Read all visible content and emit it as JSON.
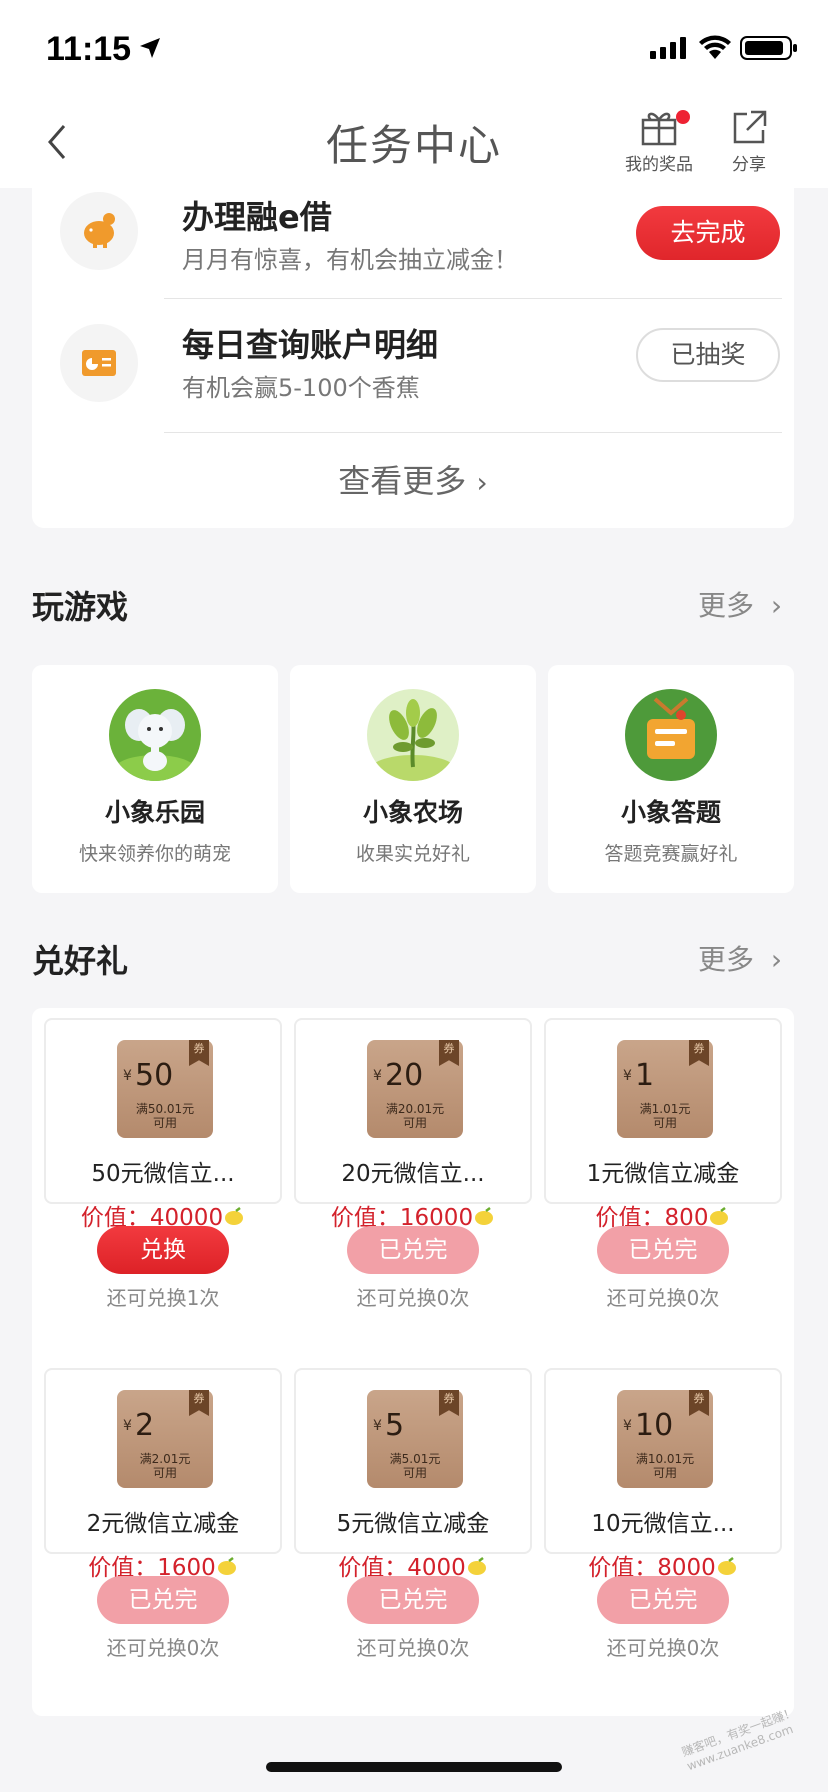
{
  "status": {
    "time": "11:15"
  },
  "nav": {
    "title": "任务中心",
    "prize_label": "我的奖品",
    "share_label": "分享"
  },
  "tasks": [
    {
      "title": "办理融e借",
      "subtitle": "月月有惊喜，有机会抽立减金！",
      "button": "去完成"
    },
    {
      "title": "每日查询账户明细",
      "subtitle": "有机会赢5-100个香蕉",
      "button": "已抽奖"
    }
  ],
  "see_more": "查看更多",
  "games": {
    "title": "玩游戏",
    "more": "更多",
    "items": [
      {
        "name": "小象乐园",
        "desc": "快来领养你的萌宠"
      },
      {
        "name": "小象农场",
        "desc": "收果实兑好礼"
      },
      {
        "name": "小象答题",
        "desc": "答题竞赛赢好礼"
      }
    ]
  },
  "gifts": {
    "title": "兑好礼",
    "more": "更多",
    "coupon_tag": "券",
    "yen": "¥",
    "usable": "可用",
    "price_label": "价值：",
    "items": [
      {
        "amount": "50",
        "condition": "满50.01元",
        "name": "50元微信立...",
        "price": "40000",
        "button": "兑换",
        "remain": "还可兑换1次"
      },
      {
        "amount": "20",
        "condition": "满20.01元",
        "name": "20元微信立...",
        "price": "16000",
        "button": "已兑完",
        "remain": "还可兑换0次"
      },
      {
        "amount": "1",
        "condition": "满1.01元",
        "name": "1元微信立减金",
        "price": "800",
        "button": "已兑完",
        "remain": "还可兑换0次"
      },
      {
        "amount": "2",
        "condition": "满2.01元",
        "name": "2元微信立减金",
        "price": "1600",
        "button": "已兑完",
        "remain": "还可兑换0次"
      },
      {
        "amount": "5",
        "condition": "满5.01元",
        "name": "5元微信立减金",
        "price": "4000",
        "button": "已兑完",
        "remain": "还可兑换0次"
      },
      {
        "amount": "10",
        "condition": "满10.01元",
        "name": "10元微信立...",
        "price": "8000",
        "button": "已兑完",
        "remain": "还可兑换0次"
      }
    ]
  },
  "watermark": "赚客吧，有奖一起赚！ www.zuanke8.com",
  "colors": {
    "accent": "#e0262b",
    "disabled": "#f2a0a7",
    "price": "#d3212b"
  }
}
